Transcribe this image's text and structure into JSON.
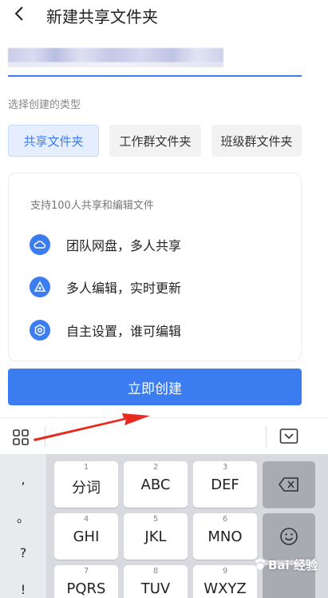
{
  "header": {
    "title": "新建共享文件夹",
    "back_icon": "chevron-left-icon"
  },
  "form": {
    "type_label": "选择创建的类型",
    "types": [
      {
        "label": "共享文件夹",
        "selected": true
      },
      {
        "label": "工作群文件夹",
        "selected": false
      },
      {
        "label": "班级群文件夹",
        "selected": false
      }
    ]
  },
  "card": {
    "description": "支持100人共享和编辑文件",
    "features": [
      {
        "icon": "cloud-icon",
        "text": "团队网盘，多人共享"
      },
      {
        "icon": "triangle-edit-icon",
        "text": "多人编辑，实时更新"
      },
      {
        "icon": "hexagon-settings-icon",
        "text": "自主设置，谁可编辑"
      }
    ]
  },
  "create_button": {
    "label": "立即创建"
  },
  "keyboard": {
    "symbols": [
      ",",
      "。",
      "?",
      "!"
    ],
    "keys": [
      {
        "num": "1",
        "label": "分词"
      },
      {
        "num": "2",
        "label": "ABC"
      },
      {
        "num": "3",
        "label": "DEF"
      },
      {
        "num": "4",
        "label": "GHI"
      },
      {
        "num": "5",
        "label": "JKL"
      },
      {
        "num": "6",
        "label": "MNO"
      },
      {
        "num": "7",
        "label": "PQRS"
      },
      {
        "num": "8",
        "label": "TUV"
      },
      {
        "num": "9",
        "label": "WXYZ"
      }
    ]
  },
  "watermark": {
    "text": "Bai 经验"
  },
  "colors": {
    "accent": "#3b7cf0",
    "arrow": "#e8291f",
    "keyboard_bg": "#d8dadf"
  }
}
